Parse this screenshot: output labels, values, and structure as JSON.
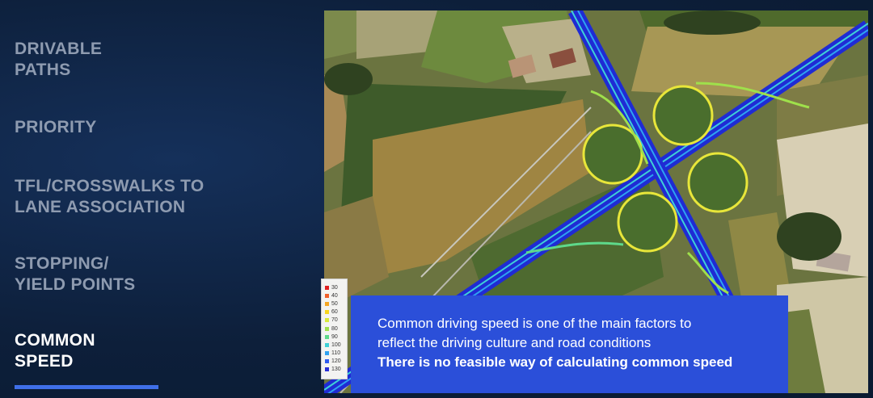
{
  "menu": {
    "items": [
      {
        "label": "DRIVABLE\nPATHS",
        "active": false
      },
      {
        "label": "PRIORITY",
        "active": false
      },
      {
        "label": "TFL/CROSSWALKS  TO\nLANE ASSOCIATION",
        "active": false
      },
      {
        "label": "STOPPING/\nYIELD POINTS",
        "active": false
      },
      {
        "label": "COMMON\nSPEED",
        "active": true
      }
    ],
    "accent_color": "#3f6fe8"
  },
  "map": {
    "description_icon": "aerial-map-interchange"
  },
  "legend": {
    "entries": [
      {
        "value": "30",
        "color": "#e02020"
      },
      {
        "value": "40",
        "color": "#f0602a"
      },
      {
        "value": "50",
        "color": "#f5a623"
      },
      {
        "value": "60",
        "color": "#f7d51d"
      },
      {
        "value": "70",
        "color": "#d9e93a"
      },
      {
        "value": "80",
        "color": "#9fe04b"
      },
      {
        "value": "90",
        "color": "#5ed98a"
      },
      {
        "value": "100",
        "color": "#3fd0d6"
      },
      {
        "value": "110",
        "color": "#2fa2f0"
      },
      {
        "value": "120",
        "color": "#2f5cf0"
      },
      {
        "value": "130",
        "color": "#2a2fd6"
      }
    ]
  },
  "caption": {
    "line1": "Common driving speed is one of the main factors to",
    "line2": "reflect the driving culture and road conditions",
    "line3": "There is no feasible way of calculating common speed",
    "background": "#2b4fd9"
  }
}
